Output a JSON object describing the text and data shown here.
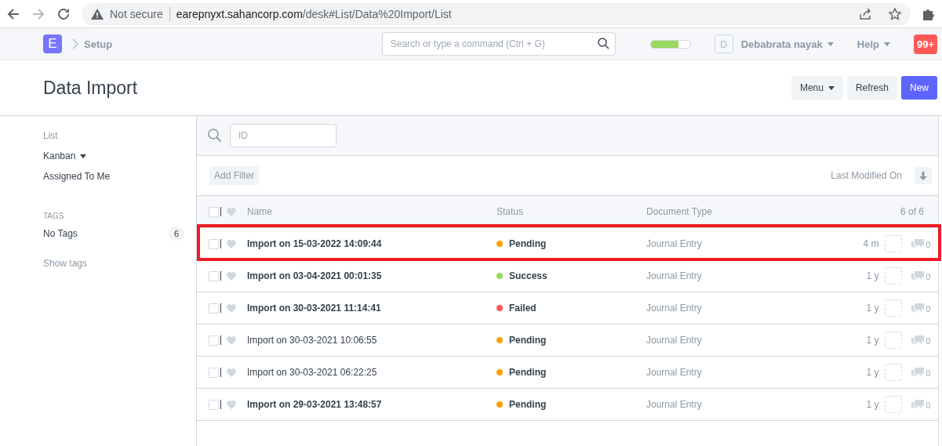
{
  "browser": {
    "security": "Not secure",
    "url_host": "earepnyxt.sahancorp.com",
    "url_path": "/desk#List/Data%20Import/List"
  },
  "navbar": {
    "logo": "E",
    "breadcrumb": "Setup",
    "search": {
      "placeholder": "Search or type a command (Ctrl + G)"
    },
    "progress": {
      "level": 0.7
    },
    "avatar": "D",
    "user": "Debabrata nayak",
    "help": "Help",
    "notifications": "99+"
  },
  "page": {
    "title": "Data Import",
    "buttons": [
      {
        "label": "Menu",
        "kind": "dropdown"
      },
      {
        "label": "Refresh",
        "kind": "default"
      },
      {
        "label": "New",
        "kind": "primary"
      }
    ]
  },
  "sidebar": {
    "items": [
      {
        "label": "List",
        "kind": "muted"
      },
      {
        "label": "Kanban",
        "kind": "dropdown"
      },
      {
        "label": "Assigned To Me",
        "kind": "plain"
      }
    ],
    "tags_heading": "TAGS",
    "tags": [
      {
        "label": "No Tags",
        "count": "6"
      }
    ],
    "show_tags": "Show tags"
  },
  "list": {
    "filter": {
      "placeholder": "ID"
    },
    "add_filter": "Add Filter",
    "sort": "Last Modified On",
    "select_all_checked": false,
    "columns": [
      "Name",
      "Status",
      "Document Type"
    ],
    "count": "6 of 6",
    "rows": [
      {
        "name": "Import on 15-03-2022 14:09:44",
        "checked": false,
        "unread": true,
        "highlighted": true,
        "status": "Pending",
        "color": "#ffa00a",
        "doctype": "Journal Entry",
        "age": "4 m",
        "comments": "0"
      },
      {
        "name": "Import on 03-04-2021 00:01:35",
        "checked": false,
        "unread": true,
        "highlighted": false,
        "status": "Success",
        "color": "#98d85b",
        "doctype": "Journal Entry",
        "age": "1 y",
        "comments": "0"
      },
      {
        "name": "Import on 30-03-2021 11:14:41",
        "checked": false,
        "unread": true,
        "highlighted": false,
        "status": "Failed",
        "color": "#ff5858",
        "doctype": "Journal Entry",
        "age": "1 y",
        "comments": "0"
      },
      {
        "name": "Import on 30-03-2021 10:06:55",
        "checked": false,
        "unread": false,
        "highlighted": false,
        "status": "Pending",
        "color": "#ffa00a",
        "doctype": "Journal Entry",
        "age": "1 y",
        "comments": "0"
      },
      {
        "name": "Import on 30-03-2021 06:22:25",
        "checked": false,
        "unread": false,
        "highlighted": false,
        "status": "Pending",
        "color": "#ffa00a",
        "doctype": "Journal Entry",
        "age": "1 y",
        "comments": "0"
      },
      {
        "name": "Import on 29-03-2021 13:48:57",
        "checked": false,
        "unread": true,
        "highlighted": false,
        "status": "Pending",
        "color": "#ffa00a",
        "doctype": "Journal Entry",
        "age": "1 y",
        "comments": "0"
      }
    ]
  }
}
